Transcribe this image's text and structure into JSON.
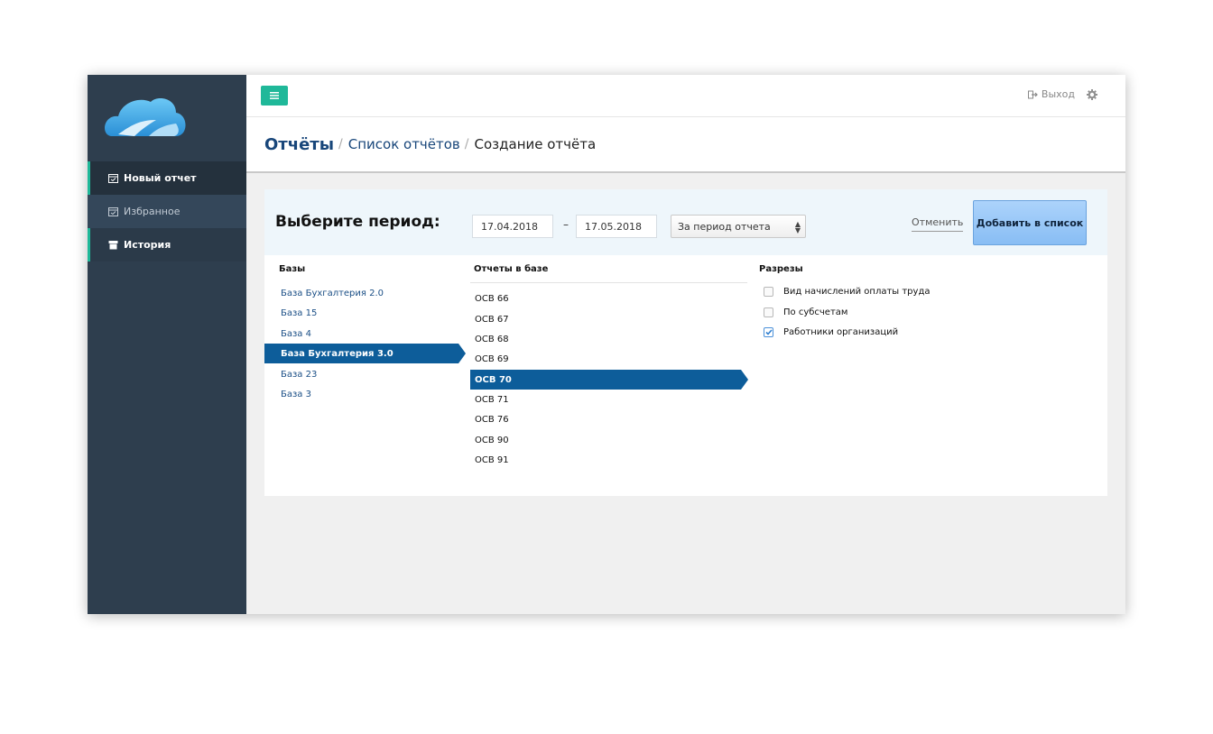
{
  "sidebar": {
    "items": [
      {
        "label": "Новый отчет",
        "icon": "calendar-check-icon"
      },
      {
        "label": "Избранное",
        "icon": "calendar-check-icon"
      },
      {
        "label": "История",
        "icon": "archive-icon"
      }
    ]
  },
  "topbar": {
    "menu_icon": "hamburger-icon",
    "logout_label": "Выход",
    "logout_icon": "sign-out-icon",
    "settings_icon": "gear-icon"
  },
  "breadcrumb": {
    "root": "Отчёты",
    "separator": "/",
    "link": "Список отчётов",
    "current": "Создание отчёта"
  },
  "period": {
    "title": "Выберите период:",
    "date_from": "17.04.2018",
    "dash": "–",
    "date_to": "17.05.2018",
    "select_value": "За период отчета",
    "cancel_label": "Отменить",
    "add_label": "Добавить в список"
  },
  "columns": {
    "bases": "Базы",
    "reports": "Отчеты в базе",
    "slices": "Разрезы"
  },
  "bases": [
    {
      "label": "База Бухгалтерия 2.0",
      "selected": false
    },
    {
      "label": "База 15",
      "selected": false
    },
    {
      "label": "База 4",
      "selected": false
    },
    {
      "label": "База Бухгалтерия 3.0",
      "selected": true
    },
    {
      "label": "База 23",
      "selected": false
    },
    {
      "label": "База 3",
      "selected": false
    }
  ],
  "reports": [
    {
      "label": "ОСВ 66",
      "selected": false
    },
    {
      "label": "ОСВ 67",
      "selected": false
    },
    {
      "label": "ОСВ 68",
      "selected": false
    },
    {
      "label": "ОСВ 69",
      "selected": false
    },
    {
      "label": "ОСВ 70",
      "selected": true
    },
    {
      "label": "ОСВ 71",
      "selected": false
    },
    {
      "label": "ОСВ 76",
      "selected": false
    },
    {
      "label": "ОСВ 90",
      "selected": false
    },
    {
      "label": "ОСВ 91",
      "selected": false
    }
  ],
  "slices": [
    {
      "label": "Вид начислений оплаты труда",
      "checked": false
    },
    {
      "label": "По субсчетам",
      "checked": false
    },
    {
      "label": "Работники организаций",
      "checked": true
    }
  ],
  "colors": {
    "accent": "#1fb899",
    "sidebar": "#2e3e4e",
    "selected": "#0d5d9a",
    "link": "#18467a"
  }
}
